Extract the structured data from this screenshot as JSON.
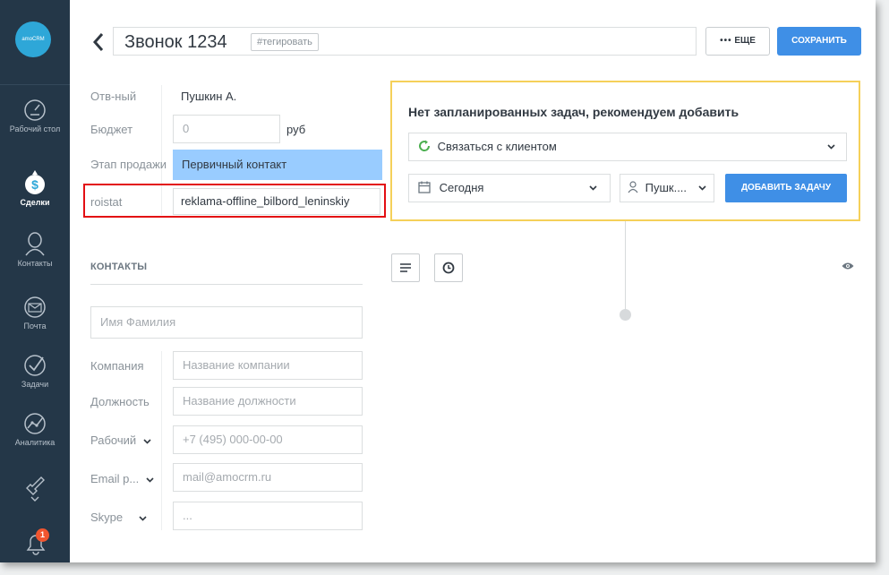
{
  "sidebar": {
    "logo_text": "amoCRM",
    "items": [
      {
        "label": "Рабочий стол",
        "icon": "dashboard-icon"
      },
      {
        "label": "Сделки",
        "icon": "deals-icon",
        "active": true
      },
      {
        "label": "Контакты",
        "icon": "contacts-icon"
      },
      {
        "label": "Почта",
        "icon": "mail-icon"
      },
      {
        "label": "Задачи",
        "icon": "tasks-icon"
      },
      {
        "label": "Аналитика",
        "icon": "analytics-icon"
      },
      {
        "label": "",
        "icon": "settings-icon"
      }
    ],
    "notification_count": "1"
  },
  "header": {
    "title": "Звонок 1234",
    "tag_label": "#тегировать",
    "more_label": "ЕЩЕ",
    "save_label": "СОХРАНИТЬ"
  },
  "lead": {
    "responsible_label": "Отв-ный",
    "responsible_value": "Пушкин А.",
    "budget_label": "Бюджет",
    "budget_placeholder": "0",
    "budget_unit": "руб",
    "stage_label": "Этап продажи",
    "stage_value": "Первичный контакт",
    "roistat_label": "roistat",
    "roistat_value": "reklama-offline_bilbord_leninskiy"
  },
  "contacts": {
    "heading": "КОНТАКТЫ",
    "name_placeholder": "Имя Фамилия",
    "company_label": "Компания",
    "company_placeholder": "Название компании",
    "position_label": "Должность",
    "position_placeholder": "Название должности",
    "phone_label": "Рабочий",
    "phone_placeholder": "+7 (495) 000-00-00",
    "email_label": "Email р...",
    "email_placeholder": "mail@amocrm.ru",
    "skype_label": "Skype",
    "skype_placeholder": "..."
  },
  "tasks": {
    "title": "Нет запланированных задач, рекомендуем добавить",
    "type_value": "Связаться с клиентом",
    "date_value": "Сегодня",
    "user_value": "Пушк....",
    "add_label": "ДОБАВИТЬ ЗАДАЧУ"
  },
  "colors": {
    "sidebar": "#243748",
    "accent": "#3f8fe6",
    "stage_bg": "#99ccff",
    "highlight": "#e30e13",
    "task_border": "#f5d05a"
  }
}
